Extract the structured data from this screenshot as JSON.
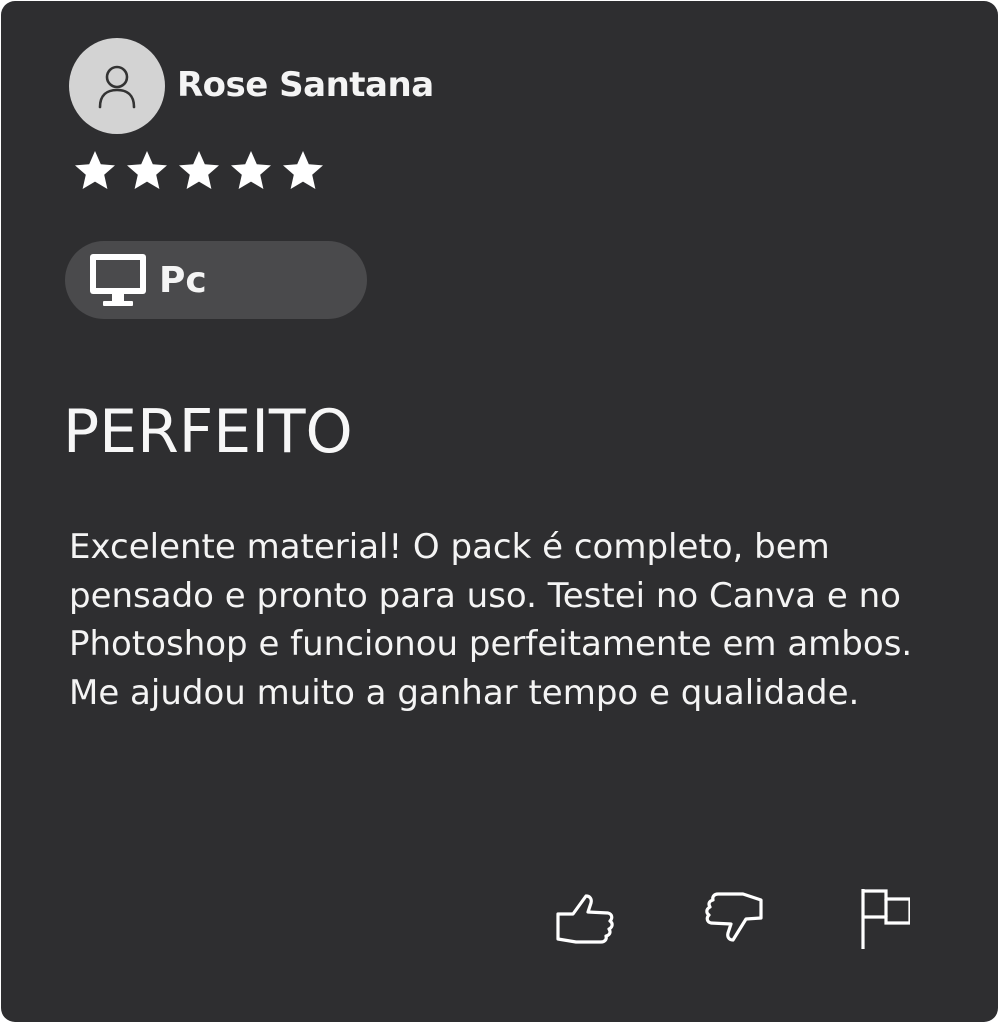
{
  "review": {
    "author": "Rose Santana",
    "rating": 5,
    "rating_max": 5,
    "platform": "Pc",
    "title": "PERFEITO",
    "body": "Excelente material! O pack é completo, bem pensado e pronto para uso. Testei no Canva e no Photoshop e funcionou perfeitamente em ambos. Me ajudou muito a ganhar tempo e qualidade."
  },
  "icons": {
    "avatar": "user-icon",
    "platform": "monitor-icon",
    "like": "thumbs-up-icon",
    "dislike": "thumbs-down-icon",
    "report": "flag-icon"
  },
  "colors": {
    "card_background": "#2e2e30",
    "pill_background": "#4a4a4c",
    "avatar_background": "#d3d3d3",
    "text": "#f4f4f4"
  }
}
